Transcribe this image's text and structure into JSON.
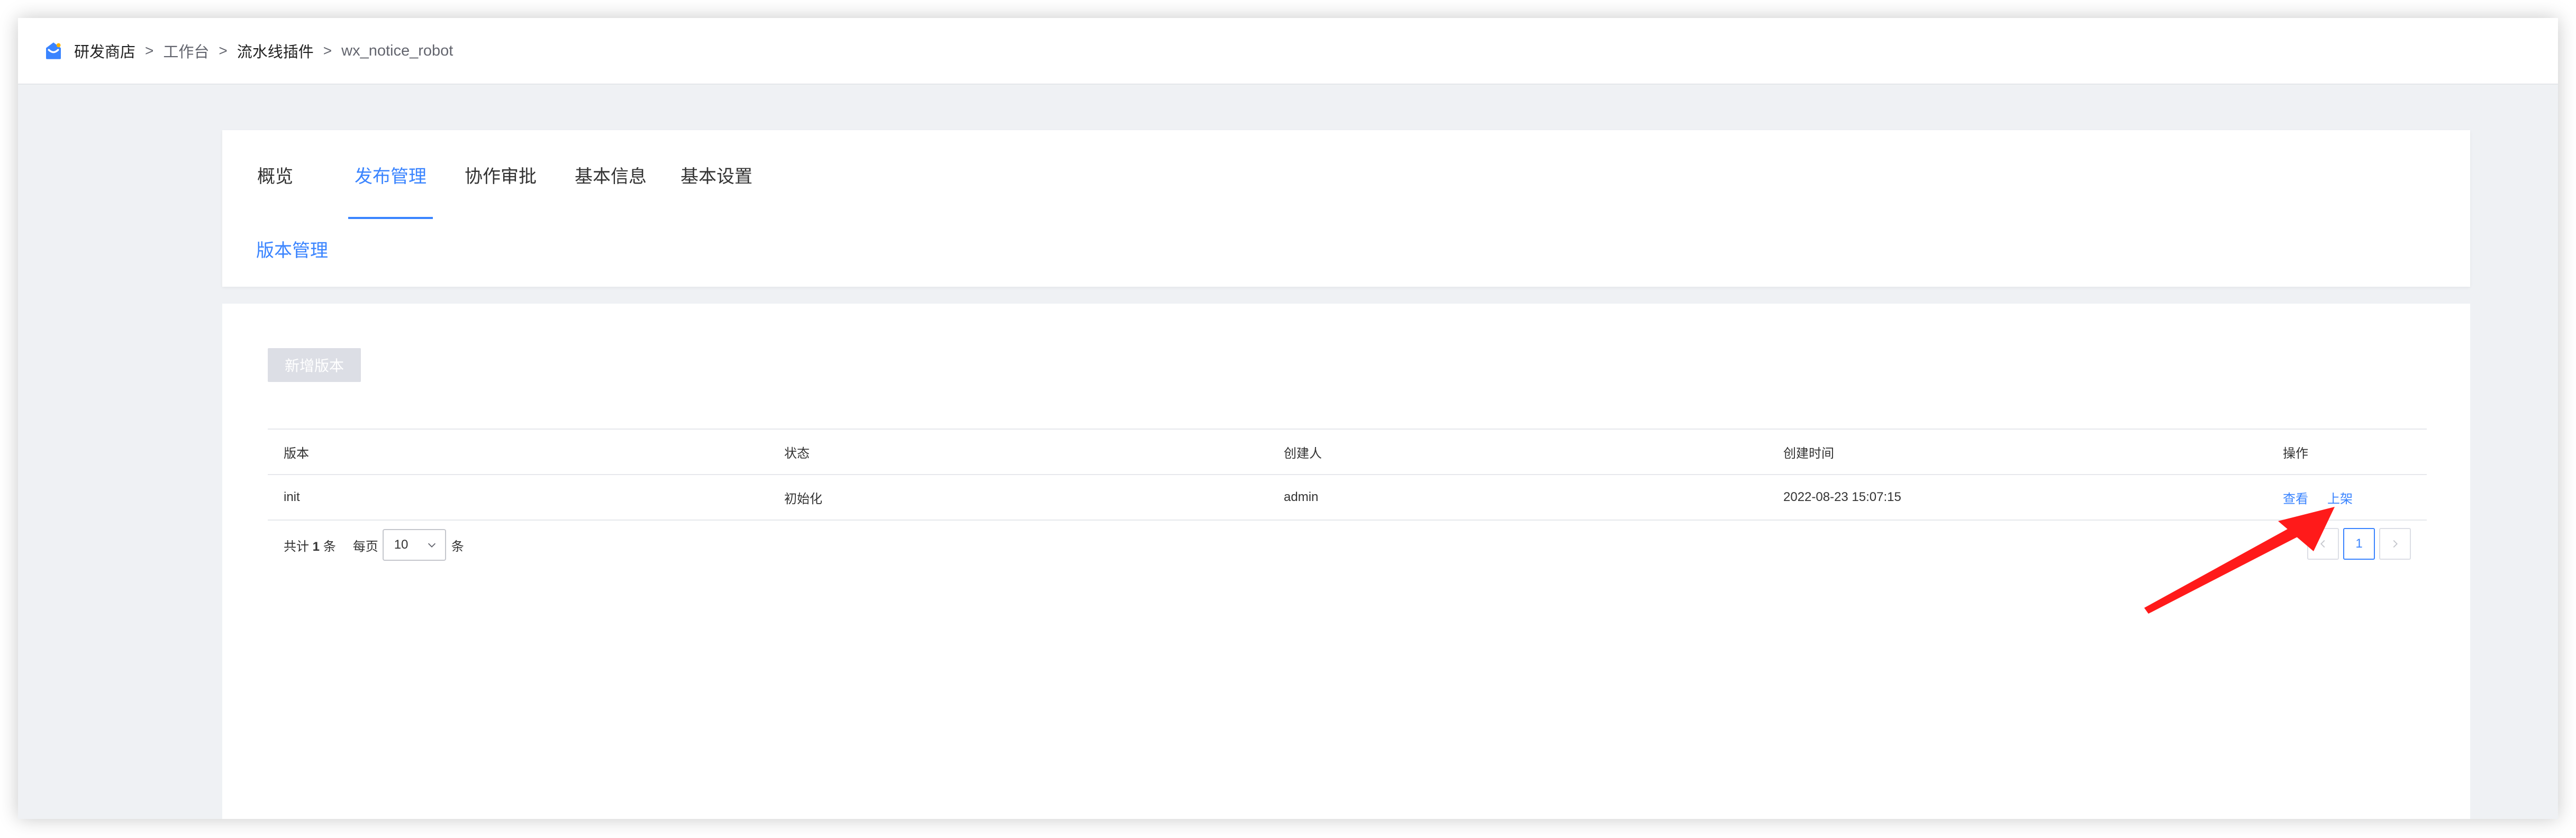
{
  "breadcrumb": {
    "items": [
      "研发商店",
      "工作台",
      "流水线插件",
      "wx_notice_robot"
    ],
    "separator": ">"
  },
  "tabs": {
    "items": [
      "概览",
      "发布管理",
      "协作审批",
      "基本信息",
      "基本设置"
    ],
    "active_index": 1,
    "subtab": "版本管理"
  },
  "main": {
    "add_button": "新增版本",
    "table": {
      "columns": [
        "版本",
        "状态",
        "创建人",
        "创建时间",
        "操作"
      ],
      "rows": [
        {
          "version": "init",
          "status": "初始化",
          "creator": "admin",
          "created_at": "2022-08-23 15:07:15",
          "actions": [
            "查看",
            "上架"
          ]
        }
      ]
    },
    "pagination": {
      "total_prefix": "共计",
      "total": "1",
      "total_suffix": "条",
      "per_page_label": "每页",
      "per_page": "10",
      "per_page_unit": "条",
      "current_page": "1"
    }
  },
  "colors": {
    "accent": "#3a84ff",
    "annotation_arrow": "#ff1a1a",
    "page_background": "#eff1f4"
  }
}
